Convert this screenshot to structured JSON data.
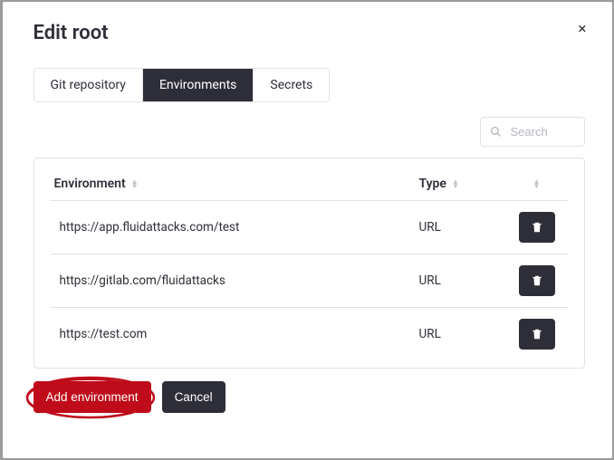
{
  "modal": {
    "title": "Edit root",
    "close": "×"
  },
  "tabs": [
    {
      "label": "Git repository",
      "active": false
    },
    {
      "label": "Environments",
      "active": true
    },
    {
      "label": "Secrets",
      "active": false
    }
  ],
  "search": {
    "placeholder": "Search"
  },
  "table": {
    "headers": {
      "environment": "Environment",
      "type": "Type"
    },
    "rows": [
      {
        "env": "https://app.fluidattacks.com/test",
        "type": "URL"
      },
      {
        "env": "https://gitlab.com/fluidattacks",
        "type": "URL"
      },
      {
        "env": "https://test.com",
        "type": "URL"
      }
    ]
  },
  "buttons": {
    "add": "Add environment",
    "cancel": "Cancel"
  }
}
